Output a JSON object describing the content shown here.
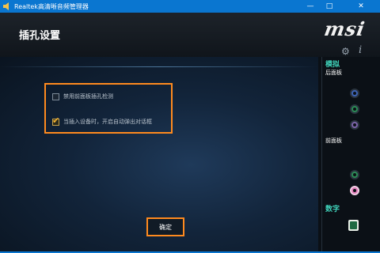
{
  "window": {
    "title": "Realtek高清晰音频管理器",
    "minimize_glyph": "—",
    "maximize_glyph": "□",
    "close_glyph": "✕"
  },
  "header": {
    "page_title": "插孔设置",
    "brand_logo_text": "msi"
  },
  "main": {
    "options": [
      {
        "label": "禁用前面板插孔检测",
        "checked": false
      },
      {
        "label": "当插入设备时，开启自动弹出对话框",
        "checked": true
      }
    ],
    "ok_label": "确定"
  },
  "sidebar": {
    "settings_icon": "gear-icon",
    "info_icon": "info-icon",
    "info_glyph": "i",
    "gear_glyph": "⚙",
    "analog_label": "模拟",
    "rear_panel_label": "后面板",
    "front_panel_label": "前面板",
    "digital_label": "数字",
    "rear_jacks": [
      "blue",
      "green",
      "purple"
    ],
    "front_jacks": [
      "green",
      "pink"
    ]
  },
  "colors": {
    "titlebar": "#0a76d0",
    "accent_orange": "#ff8a1e",
    "section_teal": "#3fd0b8"
  }
}
